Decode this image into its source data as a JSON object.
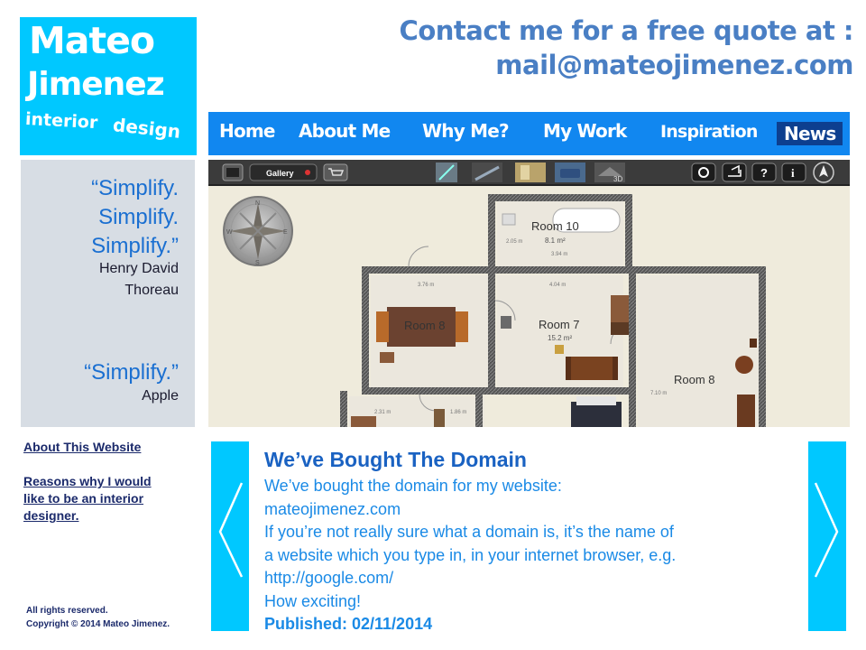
{
  "logo": {
    "line1": "Mateo",
    "line2": "Jimenez",
    "line3": "interior",
    "line4": "design"
  },
  "header": {
    "contact_line1": "Contact me for a free quote at :",
    "contact_line2": "mail@mateojimenez.com"
  },
  "nav": {
    "items": [
      "Home",
      "About Me",
      "Why Me?",
      "My Work",
      "Inspiration",
      "News"
    ],
    "active": "News"
  },
  "quotes": {
    "q1_lines": [
      "“Simplify.",
      "Simplify.",
      "Simplify.”"
    ],
    "q1_author_lines": [
      "Henry David",
      "Thoreau"
    ],
    "q2": "“Simplify.”",
    "q2_author": "Apple"
  },
  "plan": {
    "toolbar": {
      "gallery": "Gallery",
      "view3d": "3D"
    },
    "rooms": [
      {
        "name": "Room 10",
        "area": "8.1 m²"
      },
      {
        "name": "Room 8",
        "area": ""
      },
      {
        "name": "Room 7",
        "area": "15.2 m²"
      },
      {
        "name": "Room 8",
        "area": ""
      }
    ],
    "dims": [
      "3.76 m",
      "4.04 m",
      "3.94 m",
      "2.05 m",
      "2.31 m",
      "1.86 m",
      "7.10 m"
    ]
  },
  "sidebar_links": {
    "about": "About This Website",
    "reasons_lines": [
      "Reasons why I would",
      "like to be an interior",
      "designer."
    ]
  },
  "footer": {
    "rights": "All rights reserved.",
    "copyright": "Copyright © 2014 Mateo Jimenez."
  },
  "news": {
    "title": "We’ve Bought The Domain",
    "body_lines": [
      "We’ve bought the domain for my website:",
      "mateojimenez.com",
      "If you’re not really sure what a domain is, it’s the name of",
      "a website which you type in, in your internet browser, e.g.",
      "http://google.com/",
      "How exciting!"
    ],
    "published": "Published: 02/11/2014"
  },
  "colors": {
    "logo_bg": "#00c8ff",
    "nav_bg": "#1187f0",
    "nav_active_bg": "#0d3f8f",
    "contact_text": "#4a7fc4",
    "quote_bg": "#d7dde4",
    "quote_text": "#1a6fd1",
    "news_title": "#1a62c2",
    "news_text": "#1a8ae6"
  }
}
